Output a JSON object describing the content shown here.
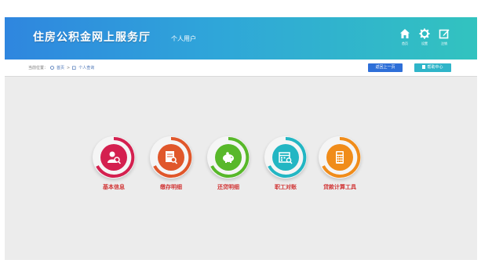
{
  "header": {
    "title": "住房公积金网上服务厅",
    "user_type": "个人用户",
    "icons": [
      {
        "name": "home-icon",
        "label": "首页"
      },
      {
        "name": "settings-icon",
        "label": "设置"
      },
      {
        "name": "edit-icon",
        "label": "注销"
      }
    ]
  },
  "breadcrumb": {
    "prefix": "当前位置：",
    "home": "首页",
    "separator": ">",
    "current": "个人查询"
  },
  "buttons": {
    "back": "返回上一页",
    "help": "帮助中心"
  },
  "tiles": [
    {
      "name": "tile-basic-info",
      "label": "基本信息",
      "icon": "user-search-icon",
      "color": "#d4204f"
    },
    {
      "name": "tile-deposit-details",
      "label": "缴存明细",
      "icon": "document-search-icon",
      "color": "#e0572b"
    },
    {
      "name": "tile-repayment-details",
      "label": "还贷明细",
      "icon": "piggy-bank-icon",
      "color": "#58b82a"
    },
    {
      "name": "tile-staff-comparison",
      "label": "职工对账",
      "icon": "calendar-search-icon",
      "color": "#23b6c3"
    },
    {
      "name": "tile-loan-calculator",
      "label": "贷款计算工具",
      "icon": "calculator-icon",
      "color": "#f08c1a"
    }
  ],
  "colors": {
    "header_start": "#2f86df",
    "header_end": "#32c3bf",
    "back_button": "#2e6fd8",
    "help_button": "#2fb5c9",
    "label_text": "#d13636"
  }
}
